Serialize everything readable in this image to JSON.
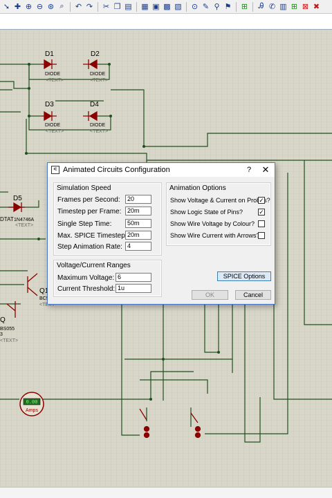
{
  "dialog": {
    "title": "Animated Circuits Configuration",
    "help_label": "?",
    "close_label": "✕",
    "simulation_speed": {
      "title": "Simulation Speed",
      "rows": [
        {
          "label": "Frames per Second:",
          "value": "20"
        },
        {
          "label": "Timestep per Frame:",
          "value": "20m"
        },
        {
          "label": "Single Step Time:",
          "value": "50m"
        },
        {
          "label": "Max. SPICE Timestep:",
          "value": "20m"
        },
        {
          "label": "Step Animation Rate:",
          "value": "4"
        }
      ]
    },
    "ranges": {
      "title": "Voltage/Current Ranges",
      "rows": [
        {
          "label": "Maximum Voltage:",
          "value": "6"
        },
        {
          "label": "Current Threshold:",
          "value": "1u"
        }
      ]
    },
    "animation_options": {
      "title": "Animation Options",
      "options": [
        {
          "label": "Show Voltage & Current on Probes?",
          "checked": "✓"
        },
        {
          "label": "Show Logic State of Pins?",
          "checked": "✓"
        },
        {
          "label": "Show Wire Voltage by Colour?",
          "checked": ""
        },
        {
          "label": "Show Wire Current with Arrows?",
          "checked": ""
        }
      ]
    },
    "spice_button": "SPICE Options",
    "ok_button": "OK",
    "cancel_button": "Cancel"
  },
  "schematic": {
    "d1": {
      "ref": "D1",
      "type": "DIODE",
      "text": "<TEXT>"
    },
    "d2": {
      "ref": "D2",
      "type": "DIODE",
      "text": "<TEXT>"
    },
    "d3": {
      "ref": "D3",
      "type": "DIODE",
      "text": "<TEXT>"
    },
    "d4": {
      "ref": "D4",
      "type": "DIODE",
      "text": "<TEXT>"
    },
    "d5": {
      "ref": "D5",
      "part": "1N4746A",
      "text": "<TEXT>",
      "left": "DTAT"
    },
    "q1": {
      "ref": "Q1",
      "part": "BC5",
      "text": "<TEXT"
    },
    "q2": {
      "ref": "Q",
      "part": "BS055",
      "text": "<TEXT>",
      "extra": "3"
    },
    "ammeter": {
      "reading": "0.00",
      "unit": "Amps"
    }
  },
  "toolbar": {
    "icons": [
      "select-arrow",
      "plus",
      "zoom-in",
      "zoom-out",
      "zoom-fit",
      "zoom-area",
      "undo",
      "redo",
      "cut",
      "copy",
      "paste",
      "block-copy",
      "block-move",
      "block-rotate",
      "block-delete",
      "find",
      "wire-autoroute",
      "search",
      "property-assign",
      "tool",
      "text-script",
      "search-replace",
      "netlist",
      "bill",
      "add-sheet",
      "remove-sheet",
      "close"
    ]
  },
  "colors": {
    "grid_bg": "#d8d6c8",
    "grid_line": "#bfbfae",
    "wire": "#1e4f1e",
    "component": "#8b0000",
    "title_accent": "#4a78c8"
  }
}
